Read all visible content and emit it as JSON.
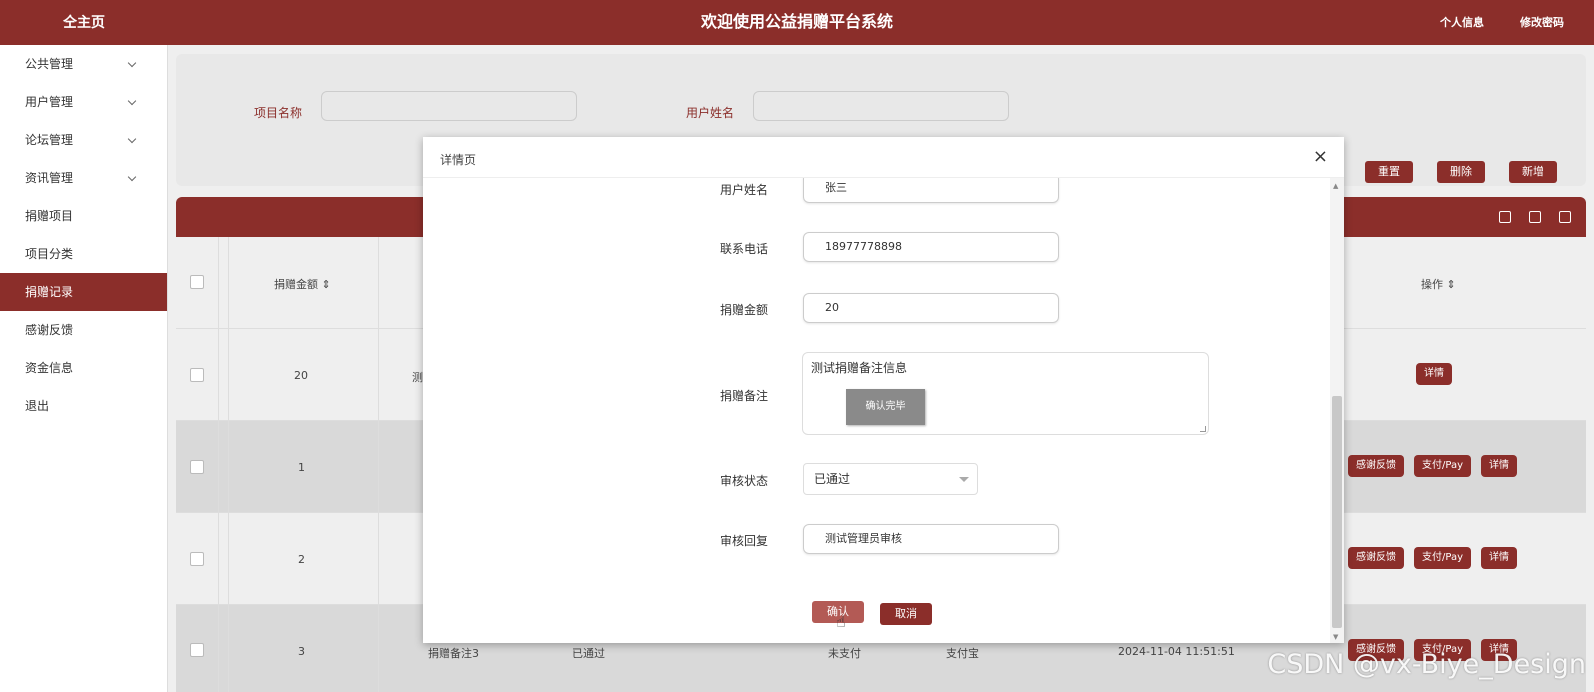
{
  "topbar": {
    "home": "仝主页",
    "title": "欢迎使用公益捐赠平台系统",
    "profile": "个人信息",
    "password": "修改密码"
  },
  "sidebar": {
    "items": [
      {
        "label": "公共管理"
      },
      {
        "label": "用户管理"
      },
      {
        "label": "论坛管理"
      },
      {
        "label": "资讯管理"
      },
      {
        "label": "捐赠项目"
      },
      {
        "label": "项目分类"
      },
      {
        "label": "捐赠记录"
      },
      {
        "label": "感谢反馈"
      },
      {
        "label": "资金信息"
      },
      {
        "label": "退出"
      }
    ]
  },
  "search": {
    "project_label": "项目名称",
    "user_label": "用户姓名",
    "reset": "重置",
    "delete": "删除",
    "add": "新增"
  },
  "table": {
    "col_amount": "捐赠金额",
    "col_actions": "操作",
    "rows": [
      {
        "amount": "20",
        "remark": "测",
        "status": "",
        "pay": "",
        "method": "",
        "time": ""
      },
      {
        "amount": "1",
        "remark": "",
        "status": "",
        "pay": "",
        "method": "",
        "time": ""
      },
      {
        "amount": "2",
        "remark": "",
        "status": "",
        "pay": "",
        "method": "",
        "time": ""
      },
      {
        "amount": "3",
        "remark": "捐赠备注3",
        "status": "已通过",
        "pay": "未支付",
        "method": "支付宝",
        "time": "2024-11-04 11:51:51"
      }
    ],
    "btn_feedback": "感谢反馈",
    "btn_pay": "支付/Pay",
    "btn_detail": "详情"
  },
  "modal": {
    "title": "详情页",
    "close": "×",
    "fields": {
      "username_label": "用户姓名",
      "username_value": "张三",
      "phone_label": "联系电话",
      "phone_value": "18977778898",
      "amount_label": "捐赠金额",
      "amount_value": "20",
      "remark_label": "捐赠备注",
      "remark_value": "测试捐赠备注信息",
      "remark_inner_btn": "确认完毕",
      "status_label": "审核状态",
      "status_value": "已通过",
      "reply_label": "审核回复",
      "reply_value": "测试管理员审核"
    },
    "confirm": "确认",
    "cancel": "取消"
  },
  "watermark": "CSDN @vx-Biye_Design",
  "colors": {
    "brand": "#8b2e2a"
  }
}
